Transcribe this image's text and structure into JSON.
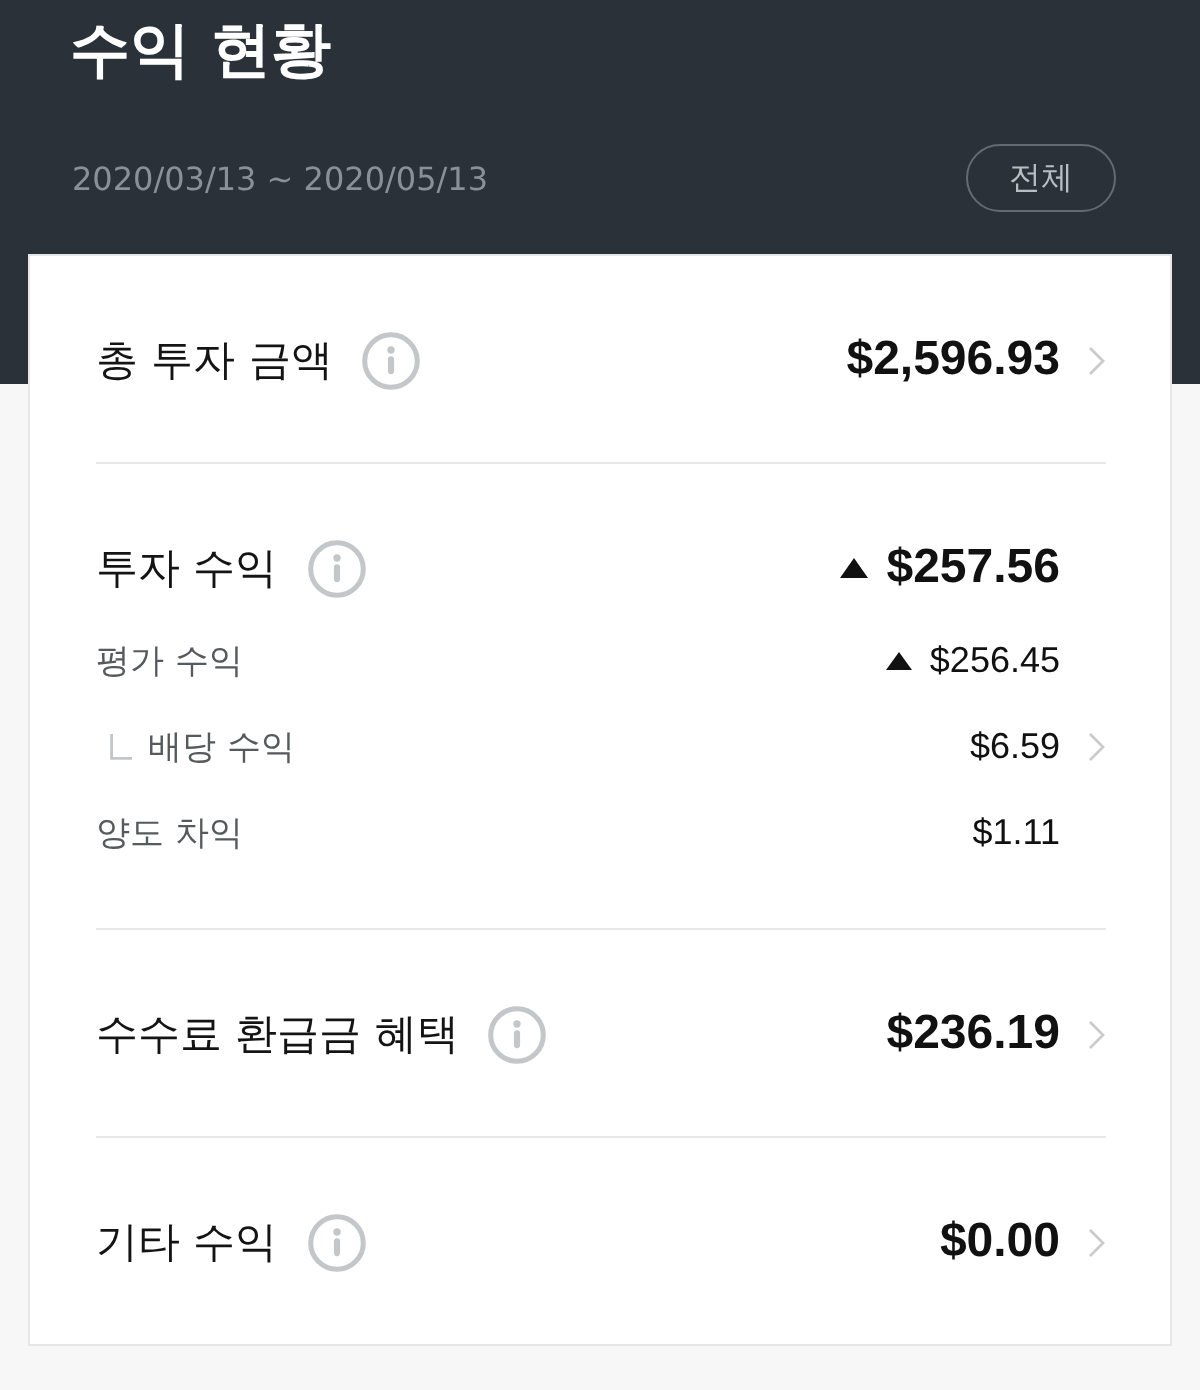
{
  "header": {
    "title": "수익 현황",
    "date_range": "2020/03/13 ~ 2020/05/13",
    "period_button": "전체"
  },
  "sections": [
    {
      "label": "총 투자 금액",
      "info": true,
      "trend_up": false,
      "value": "$2,596.93",
      "chevron": true
    },
    {
      "label": "투자 수익",
      "info": true,
      "trend_up": true,
      "value": "$257.56",
      "chevron": false,
      "details": [
        {
          "label": "평가 수익",
          "trend_up": true,
          "value": "$256.45",
          "chevron": false,
          "children": [
            {
              "label": "배당 수익",
              "trend_up": false,
              "value": "$6.59",
              "chevron": true
            }
          ]
        },
        {
          "label": "양도 차익",
          "trend_up": false,
          "value": "$1.11",
          "chevron": false
        }
      ]
    },
    {
      "label": "수수료 환급금 혜택",
      "info": true,
      "trend_up": false,
      "value": "$236.19",
      "chevron": true
    },
    {
      "label": "기타 수익",
      "info": true,
      "trend_up": false,
      "value": "$0.00",
      "chevron": true
    }
  ]
}
